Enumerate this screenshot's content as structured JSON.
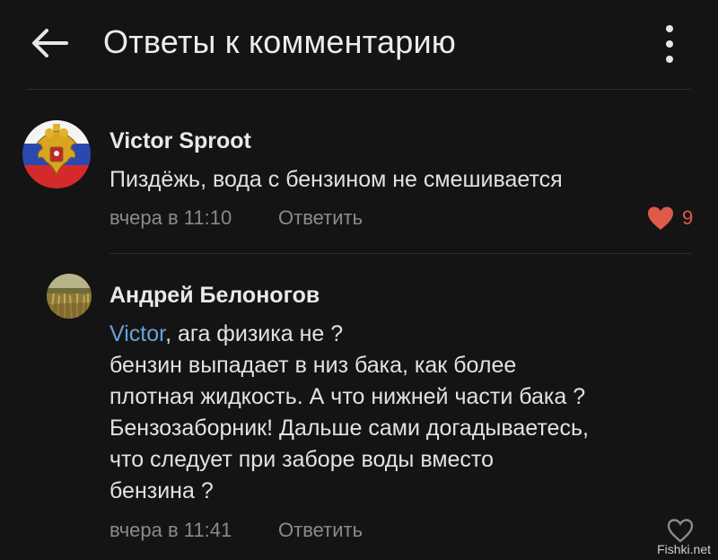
{
  "header": {
    "title": "Ответы к комментарию"
  },
  "comments": [
    {
      "author": "Victor Sproot",
      "text": "Пиздёжь, вода с бензином не смешивается",
      "time": "вчера в 11:10",
      "reply_label": "Ответить",
      "likes": "9",
      "liked": true
    },
    {
      "author": "Андрей Белоногов",
      "mention": "Victor",
      "lines": [
        ", ага физика не ?",
        "бензин выпадает в низ бака, как более",
        "плотная жидкость. А что нижней части бака ?",
        "Бензозаборник! Дальше сами догадываетесь,",
        "что следует при заборе воды вместо",
        "бензина ?"
      ],
      "time": "вчера в 11:41",
      "reply_label": "Ответить",
      "liked": false
    }
  ],
  "watermark": "Fishki.net",
  "colors": {
    "background": "#141414",
    "like": "#e05a4a",
    "mention": "#6aa0d8"
  }
}
